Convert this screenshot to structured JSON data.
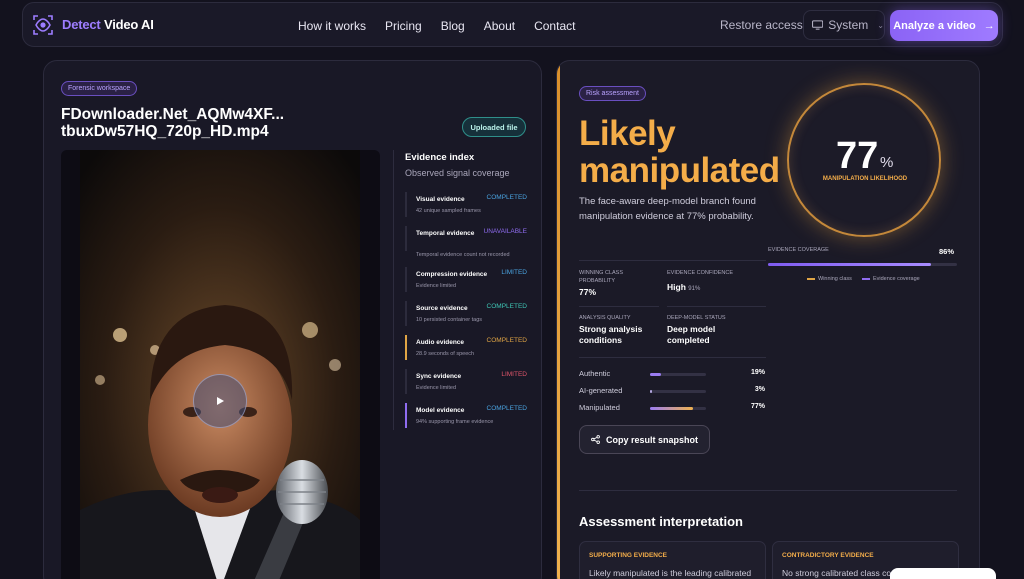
{
  "brand": {
    "name_a": "Detect",
    "name_b": " Video AI",
    "logo_icon": "eye-scan-icon",
    "accent": "#9d7dff"
  },
  "nav": {
    "links": [
      "How it works",
      "Pricing",
      "Blog",
      "About",
      "Contact"
    ],
    "restore": "Restore access",
    "theme": "System",
    "cta": "Analyze a video"
  },
  "workspace": {
    "badge": "Forensic workspace",
    "file_line1": "FDownloader.Net_AQMw4XF...",
    "file_line2": "tbuxDw57HQ_720p_HD.mp4",
    "upload_badge": "Uploaded file"
  },
  "evidence": {
    "title": "Evidence index",
    "subtitle": "Observed signal coverage",
    "items": [
      {
        "name": "Visual evidence",
        "status": "COMPLETED",
        "detail": "42 unique sampled frames",
        "status_color": "#4aa3e0",
        "bar": "#2c2b3c"
      },
      {
        "name": "Temporal evidence",
        "status": "UNAVAILABLE",
        "detail": "Temporal evidence count not recorded",
        "status_color": "#8f6cf0",
        "bar": "#2c2b3c"
      },
      {
        "name": "Compression evidence",
        "status": "LIMITED",
        "detail": "Evidence limited",
        "status_color": "#4aa3e0",
        "bar": "#2c2b3c"
      },
      {
        "name": "Source evidence",
        "status": "COMPLETED",
        "detail": "10 persisted container tags",
        "status_color": "#3fc7b6",
        "bar": "#2c2b3c"
      },
      {
        "name": "Audio evidence",
        "status": "COMPLETED",
        "detail": "28.9 seconds of speech",
        "status_color": "#e0a545",
        "bar": "#e0a545"
      },
      {
        "name": "Sync evidence",
        "status": "LIMITED",
        "detail": "Evidence limited",
        "status_color": "#e0556a",
        "bar": "#2c2b3c"
      },
      {
        "name": "Model evidence",
        "status": "COMPLETED",
        "detail": "94% supporting frame evidence",
        "status_color": "#4aa3e0",
        "bar": "#8f6cf0"
      }
    ]
  },
  "assessment": {
    "badge": "Risk assessment",
    "verdict_line1": "Likely",
    "verdict_line2": "manipulated",
    "description": "The face-aware deep-model branch found manipulation evidence at 77% probability.",
    "gauge_value": "77",
    "gauge_unit": "%",
    "gauge_label": "MANIPULATION LIKELIHOOD",
    "coverage_label": "EVIDENCE COVERAGE",
    "coverage_value": "86%",
    "coverage_fraction": 0.86,
    "legend": [
      "Winning class",
      "Evidence coverage"
    ],
    "stats": [
      {
        "label": "WINNING CLASS PROBABILITY",
        "value": "77%",
        "extra": ""
      },
      {
        "label": "EVIDENCE CONFIDENCE",
        "value": "High",
        "extra": "91%"
      },
      {
        "label": "ANALYSIS QUALITY",
        "value": "Strong analysis conditions",
        "extra": ""
      },
      {
        "label": "DEEP-MODEL STATUS",
        "value": "Deep model completed",
        "extra": ""
      }
    ],
    "probabilities": [
      {
        "name": "Authentic",
        "value": "19%",
        "fraction": 0.19,
        "color": "#9b7df2"
      },
      {
        "name": "AI-generated",
        "value": "3%",
        "fraction": 0.03,
        "color": "#b3a6e0"
      },
      {
        "name": "Manipulated",
        "value": "77%",
        "fraction": 0.77,
        "color": "#d89a55"
      }
    ],
    "copy_button": "Copy result snapshot"
  },
  "interpretation": {
    "title": "Assessment interpretation",
    "supporting_header": "SUPPORTING EVIDENCE",
    "supporting_text": "Likely manipulated is the leading calibrated",
    "contradictory_header": "CONTRADICTORY EVIDENCE",
    "contradictory_text": "No strong calibrated class co"
  }
}
